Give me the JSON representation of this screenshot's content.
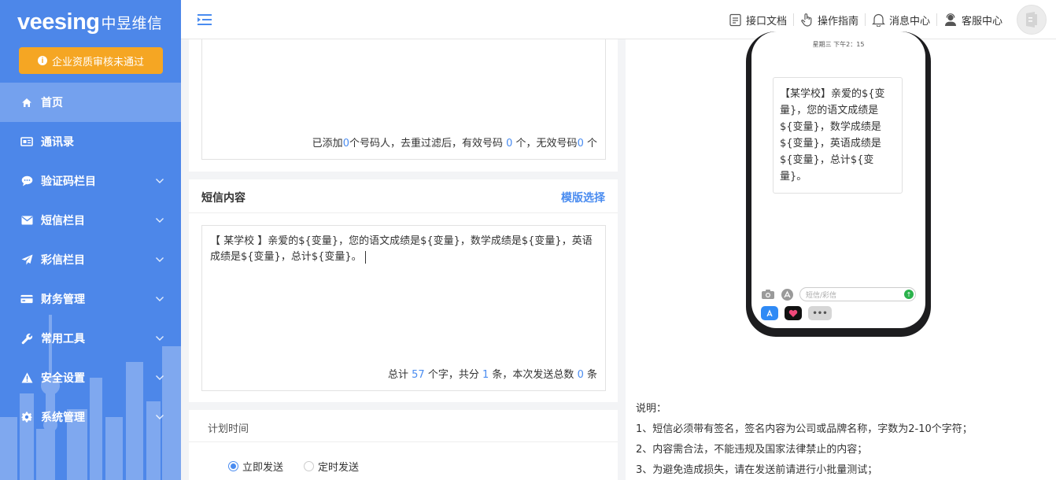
{
  "brand": {
    "logo_en": "veesing",
    "logo_cn": "中昱维信"
  },
  "warning": {
    "label": "企业资质审核未通过"
  },
  "menu": [
    {
      "label": "首页",
      "icon": "home-icon",
      "arrow": false,
      "active": true
    },
    {
      "label": "通讯录",
      "icon": "address-book-icon",
      "arrow": false
    },
    {
      "label": "验证码栏目",
      "icon": "chat-icon",
      "arrow": true
    },
    {
      "label": "短信栏目",
      "icon": "mail-icon",
      "arrow": true
    },
    {
      "label": "彩信栏目",
      "icon": "send-icon",
      "arrow": true
    },
    {
      "label": "财务管理",
      "icon": "card-icon",
      "arrow": true
    },
    {
      "label": "常用工具",
      "icon": "wrench-icon",
      "arrow": true
    },
    {
      "label": "安全设置",
      "icon": "warning-icon",
      "arrow": true
    },
    {
      "label": "系统管理",
      "icon": "gear-icon",
      "arrow": true
    }
  ],
  "header": {
    "api_doc": "接口文档",
    "guide": "操作指南",
    "messages": "消息中心",
    "service": "客服中心"
  },
  "numbers": {
    "prefix": "已添加",
    "added": "0",
    "mid": "个号码人，去重过滤后，有效号码",
    "valid": "0",
    "mid2": "个，无效号码",
    "invalid": "0",
    "suffix": "个"
  },
  "sms": {
    "title": "短信内容",
    "template_link": "模版选择",
    "content": "【 某学校 】亲爱的${变量}，您的语文成绩是${变量}，数学成绩是${变量}，英语成绩是${变量}，总计${变量}。",
    "count": {
      "prefix": "总计",
      "chars": "57",
      "mid": "个字，共分",
      "parts": "1",
      "mid2": "条，本次发送总数",
      "total": "0",
      "suffix": "条"
    }
  },
  "plan": {
    "title": "计划时间",
    "options": [
      {
        "label": "立即发送",
        "selected": true
      },
      {
        "label": "定时发送",
        "selected": false
      }
    ]
  },
  "preview": {
    "time": "星期三 下午2：15",
    "bubble": "【某学校】亲爱的${变量}，您的语文成绩是${变量}，数学成绩是${变量}，英语成绩是${变量}，总计${变量}。",
    "input_placeholder": "短信/彩信"
  },
  "notes": {
    "title": "说明：",
    "items": [
      "1、短信必须带有签名，签名内容为公司或品牌名称，字数为2-10个字符；",
      "2、内容需合法，不能违规及国家法律禁止的内容；",
      "3、为避免造成损失，请在发送前请进行小批量测试；"
    ]
  },
  "colors": {
    "sidebar": "#4d87e9",
    "accent": "#4a8cf0",
    "warning": "#f5a623"
  }
}
